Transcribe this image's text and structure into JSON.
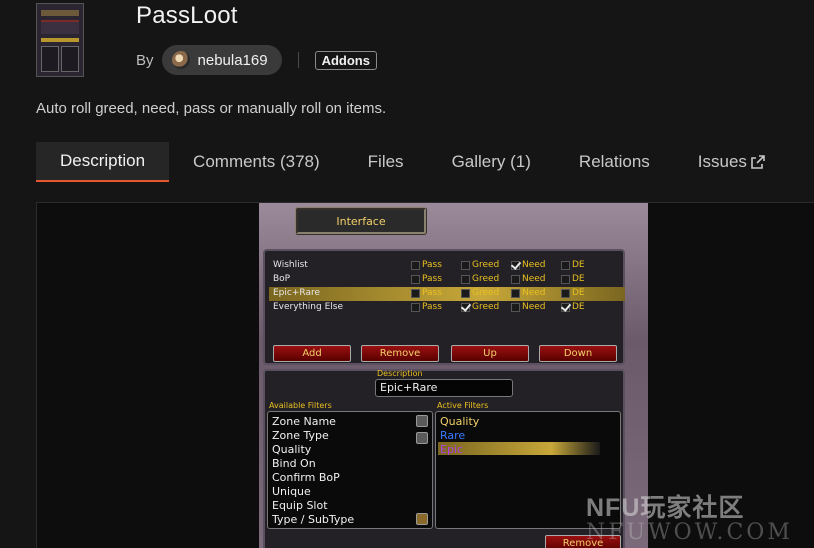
{
  "project": {
    "title": "PassLoot",
    "by_label": "By",
    "author": "nebula169",
    "category": "Addons",
    "summary": "Auto roll greed, need, pass or manually roll on items."
  },
  "tabs": [
    {
      "label": "Description",
      "active": true
    },
    {
      "label": "Comments (378)"
    },
    {
      "label": "Files"
    },
    {
      "label": "Gallery (1)"
    },
    {
      "label": "Relations"
    },
    {
      "label": "Issues"
    }
  ],
  "colors": {
    "accent": "#e4572e",
    "background": "#151515",
    "wow_gold": "#e8c020"
  },
  "addon_screenshot": {
    "header": "Interface",
    "rules": [
      {
        "name": "Wishlist",
        "pass": false,
        "greed": false,
        "need": true,
        "de": false
      },
      {
        "name": "BoP",
        "pass": false,
        "greed": false,
        "need": false,
        "de": false
      },
      {
        "name": "Epic+Rare",
        "pass": false,
        "greed": false,
        "need": false,
        "de": false,
        "selected": true
      },
      {
        "name": "Everything Else",
        "pass": false,
        "greed": true,
        "need": false,
        "de": true
      }
    ],
    "options": [
      "Pass",
      "Greed",
      "Need",
      "DE"
    ],
    "buttons": [
      "Add",
      "Remove",
      "Up",
      "Down"
    ],
    "description_label": "Description",
    "description_value": "Epic+Rare",
    "available_filters_label": "Available Filters",
    "available_filters": [
      "Zone Name",
      "Zone Type",
      "Quality",
      "Bind On",
      "Confirm BoP",
      "Unique",
      "Equip Slot",
      "Type / SubType"
    ],
    "active_filters_label": "Active Filters",
    "active_filters": [
      {
        "label": "Quality",
        "color": "#f1d06a"
      },
      {
        "label": "Rare",
        "color": "#3a7aff"
      },
      {
        "label": "Epic",
        "color": "#b040e0"
      }
    ],
    "remove_button": "Remove"
  },
  "watermark": {
    "line1": "NFU玩家社区",
    "line2": "NFUWOW.COM"
  }
}
